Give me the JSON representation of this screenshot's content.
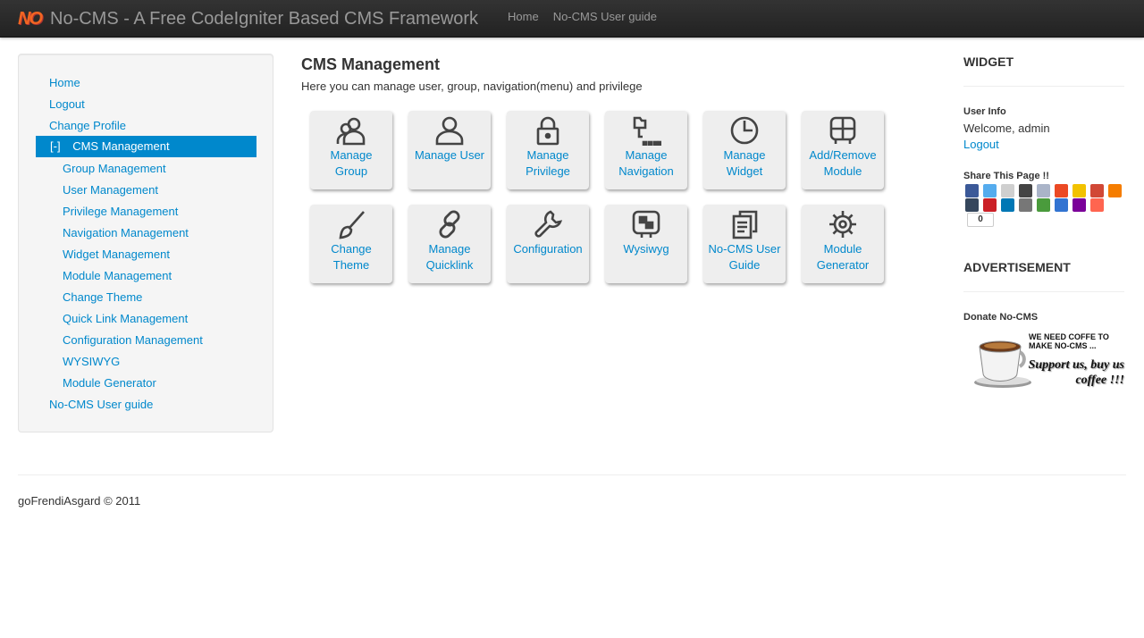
{
  "navbar": {
    "logo_text": "NO",
    "title": "No-CMS - A Free CodeIgniter Based CMS Framework",
    "links": [
      "Home",
      "No-CMS User guide"
    ]
  },
  "sidebar": {
    "top_items": [
      "Home",
      "Logout",
      "Change Profile"
    ],
    "active": {
      "toggle": "[-]",
      "label": "CMS Management"
    },
    "sub_items": [
      "Group Management",
      "User Management",
      "Privilege Management",
      "Navigation Management",
      "Widget Management",
      "Module Management",
      "Change Theme",
      "Quick Link Management",
      "Configuration Management",
      "WYSIWYG",
      "Module Generator"
    ],
    "bottom_item": "No-CMS User guide"
  },
  "main": {
    "title": "CMS Management",
    "description": "Here you can manage user, group, navigation(menu) and privilege",
    "tiles": [
      {
        "l1": "Manage",
        "l2": "Group",
        "icon": "group-icon"
      },
      {
        "l1": "Manage User",
        "l2": "",
        "icon": "user-icon"
      },
      {
        "l1": "Manage",
        "l2": "Privilege",
        "icon": "lock-icon"
      },
      {
        "l1": "Manage",
        "l2": "Navigation",
        "icon": "sitemap-icon"
      },
      {
        "l1": "Manage",
        "l2": "Widget",
        "icon": "clock-icon"
      },
      {
        "l1": "Add/Remove",
        "l2": "Module",
        "icon": "module-icon"
      },
      {
        "l1": "Change",
        "l2": "Theme",
        "icon": "brush-icon"
      },
      {
        "l1": "Manage",
        "l2": "Quicklink",
        "icon": "link-icon"
      },
      {
        "l1": "Configuration",
        "l2": "",
        "icon": "wrench-icon"
      },
      {
        "l1": "Wysiwyg",
        "l2": "",
        "icon": "wysiwyg-icon"
      },
      {
        "l1": "No-CMS User",
        "l2": "Guide",
        "icon": "document-icon"
      },
      {
        "l1": "Module",
        "l2": "Generator",
        "icon": "gear-icon"
      }
    ]
  },
  "widget": {
    "heading": "WIDGET",
    "user_info_label": "User Info",
    "welcome": "Welcome, admin",
    "logout": "Logout",
    "share_label": "Share This Page !!",
    "share_count": "0",
    "share_icons": [
      {
        "name": "facebook-icon",
        "color": "#3b5998"
      },
      {
        "name": "twitter-icon",
        "color": "#55acee"
      },
      {
        "name": "email-icon",
        "color": "#cfcfcf"
      },
      {
        "name": "print-icon",
        "color": "#444444"
      },
      {
        "name": "reddit-icon",
        "color": "#aab4c8"
      },
      {
        "name": "stumbleupon-icon",
        "color": "#eb4924"
      },
      {
        "name": "favorites-icon",
        "color": "#f2c200"
      },
      {
        "name": "gmail-icon",
        "color": "#d14836"
      },
      {
        "name": "blogger-icon",
        "color": "#f57d00"
      },
      {
        "name": "tumblr-icon",
        "color": "#35465c"
      },
      {
        "name": "pinterest-icon",
        "color": "#cb2027"
      },
      {
        "name": "linkedin-icon",
        "color": "#0077b5"
      },
      {
        "name": "digg-icon",
        "color": "#777777"
      },
      {
        "name": "google-bookmarks-icon",
        "color": "#4a9b3c"
      },
      {
        "name": "delicious-icon",
        "color": "#3274d1"
      },
      {
        "name": "yahoo-icon",
        "color": "#7b0099"
      },
      {
        "name": "addthis-more-icon",
        "color": "#ff6550"
      }
    ],
    "ad_heading": "ADVERTISEMENT",
    "donate_label": "Donate No-CMS",
    "banner_top": "WE NEED COFFE TO MAKE NO-CMS ...",
    "banner_script": "Support us, buy us coffee !!!"
  },
  "footer": {
    "text": "goFrendiAsgard © 2011"
  }
}
